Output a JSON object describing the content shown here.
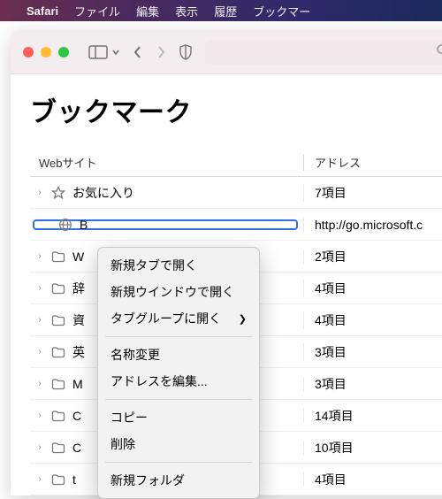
{
  "menubar": {
    "app": "Safari",
    "items": [
      "ファイル",
      "編集",
      "表示",
      "履歴",
      "ブックマー"
    ]
  },
  "toolbar": {
    "traffic": [
      "close",
      "minimize",
      "zoom"
    ]
  },
  "page": {
    "title": "ブックマーク",
    "col_site": "Webサイト",
    "col_addr": "アドレス"
  },
  "rows": [
    {
      "icon": "star",
      "label": "お気に入り",
      "addr": "7項目"
    },
    {
      "icon": "globe",
      "label": "B",
      "addr": "http://go.microsoft.c",
      "selected": true
    },
    {
      "icon": "folder",
      "label": "W",
      "addr": "2項目"
    },
    {
      "icon": "folder",
      "label": "辞",
      "addr": "4項目"
    },
    {
      "icon": "folder",
      "label": "資",
      "addr": "4項目"
    },
    {
      "icon": "folder",
      "label": "英",
      "addr": "3項目"
    },
    {
      "icon": "folder",
      "label": "M",
      "addr": "3項目"
    },
    {
      "icon": "folder",
      "label": "C",
      "addr": "14項目"
    },
    {
      "icon": "folder",
      "label": "C",
      "addr": "10項目"
    },
    {
      "icon": "folder",
      "label": "t",
      "addr": "4項目"
    }
  ],
  "context_menu": {
    "groups": [
      [
        "新規タブで開く",
        "新規ウインドウで開く",
        {
          "label": "タブグループに開く",
          "submenu": true
        }
      ],
      [
        "名称変更",
        "アドレスを編集..."
      ],
      [
        "コピー",
        "削除"
      ],
      [
        "新規フォルダ"
      ]
    ]
  }
}
